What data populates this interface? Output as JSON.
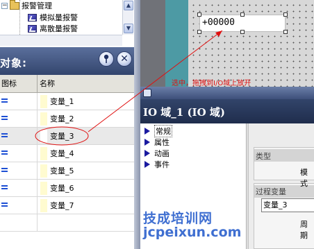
{
  "tree": {
    "items": [
      {
        "label": "报警管理",
        "icon": "folder-icon"
      },
      {
        "label": "模拟量报警",
        "icon": "analog-alarm-icon"
      },
      {
        "label": "离散量报警",
        "icon": "discrete-alarm-icon"
      }
    ],
    "collapse_glyph": "−",
    "scroll_up_glyph": "▲",
    "scroll_down_glyph": "▼"
  },
  "objects_panel": {
    "title": "对象:",
    "pin_glyph": "📍",
    "close_glyph": "✕",
    "columns": [
      "图标",
      "名称"
    ],
    "rows": [
      {
        "name": "变量_1",
        "icon": "variable-icon"
      },
      {
        "name": "变量_2",
        "icon": "variable-icon"
      },
      {
        "name": "变量_3",
        "icon": "variable-icon",
        "selected": true
      },
      {
        "name": "变量_4",
        "icon": "variable-icon"
      },
      {
        "name": "变量_5",
        "icon": "variable-icon"
      },
      {
        "name": "变量_6",
        "icon": "variable-icon"
      },
      {
        "name": "变量_7",
        "icon": "variable-icon"
      }
    ]
  },
  "canvas": {
    "io_field_value": "+00000",
    "instruction": "选中，拖拽到I/O域上放开",
    "annotation_color": "#e01010"
  },
  "properties": {
    "title": "IO 域_1 (IO 域)",
    "nav": [
      {
        "label": "常规",
        "active": true
      },
      {
        "label": "属性"
      },
      {
        "label": "动画"
      },
      {
        "label": "事件"
      }
    ],
    "type_group_label": "类型",
    "mode_label": "模式",
    "process_group_label": "过程变量",
    "process_value": "变量_3",
    "period_label": "周期"
  },
  "watermark": {
    "cn": "技成培训网",
    "url": "jcpeixun.com"
  }
}
